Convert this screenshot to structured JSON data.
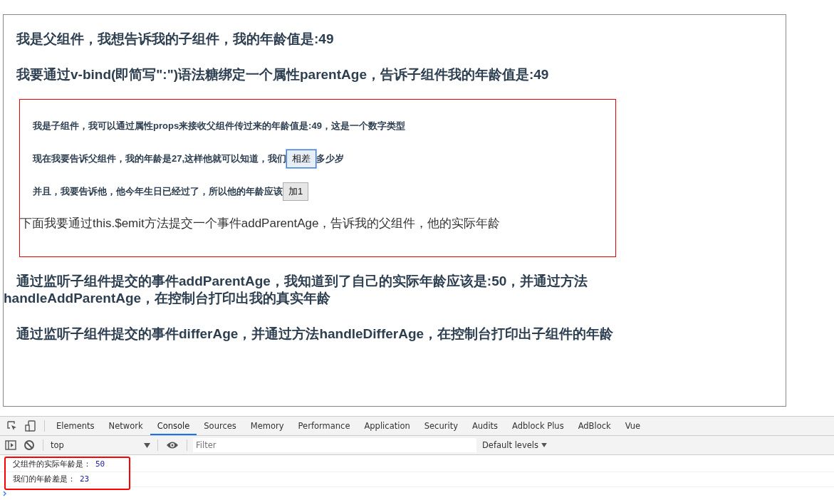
{
  "page": {
    "parent_lines": [
      "我是父组件，我想告诉我的子组件，我的年龄值是:49",
      "我要通过v-bind(即简写\":\")语法糖绑定一个属性parentAge，告诉子组件我的年龄值是:49"
    ],
    "child": {
      "lines": [
        {
          "kind": "text",
          "segments": [
            {
              "kind": "text",
              "text": "我是子组件，我可以通过属性props来接收父组件传过来的年龄值是:49，这是一个数字类型"
            }
          ]
        },
        {
          "kind": "text",
          "segments": [
            {
              "kind": "text",
              "text": "现在我要告诉父组件，我的年龄是27,这样他就可以知道，我们"
            },
            {
              "kind": "button",
              "text": "相差",
              "focused": true
            },
            {
              "kind": "text",
              "text": "多少岁"
            }
          ]
        },
        {
          "kind": "text",
          "segments": [
            {
              "kind": "text",
              "text": "并且，我要告诉他，他今年生日已经过了，所以他的年龄应该"
            },
            {
              "kind": "button",
              "text": "加1",
              "focused": false
            }
          ]
        },
        {
          "kind": "plain",
          "segments": [
            {
              "kind": "text",
              "text": "下面我要通过this.$emit方法提交一个事件addParentAge，告诉我的父组件，他的实际年龄"
            }
          ]
        }
      ]
    },
    "after_lines": [
      "通过监听子组件提交的事件addParentAge，我知道到了自己的实际年龄应该是:50，并通过方法handleAddParentAge，在控制台打印出我的真实年龄",
      "通过监听子组件提交的事件differAge，并通过方法handleDifferAge，在控制台打印出子组件的年龄"
    ]
  },
  "devtools": {
    "tabs": [
      {
        "label": "Elements",
        "selected": false
      },
      {
        "label": "Network",
        "selected": false
      },
      {
        "label": "Console",
        "selected": true
      },
      {
        "label": "Sources",
        "selected": false
      },
      {
        "label": "Memory",
        "selected": false
      },
      {
        "label": "Performance",
        "selected": false
      },
      {
        "label": "Application",
        "selected": false
      },
      {
        "label": "Security",
        "selected": false
      },
      {
        "label": "Audits",
        "selected": false
      },
      {
        "label": "Adblock Plus",
        "selected": false
      },
      {
        "label": "AdBlock",
        "selected": false
      },
      {
        "label": "Vue",
        "selected": false
      }
    ],
    "context": "top",
    "filter": {
      "placeholder": "Filter"
    },
    "levels": "Default levels",
    "messages": [
      {
        "text": "父组件的实际年龄是：",
        "value": "50"
      },
      {
        "text": "我们的年龄差是：",
        "value": "23"
      }
    ]
  }
}
